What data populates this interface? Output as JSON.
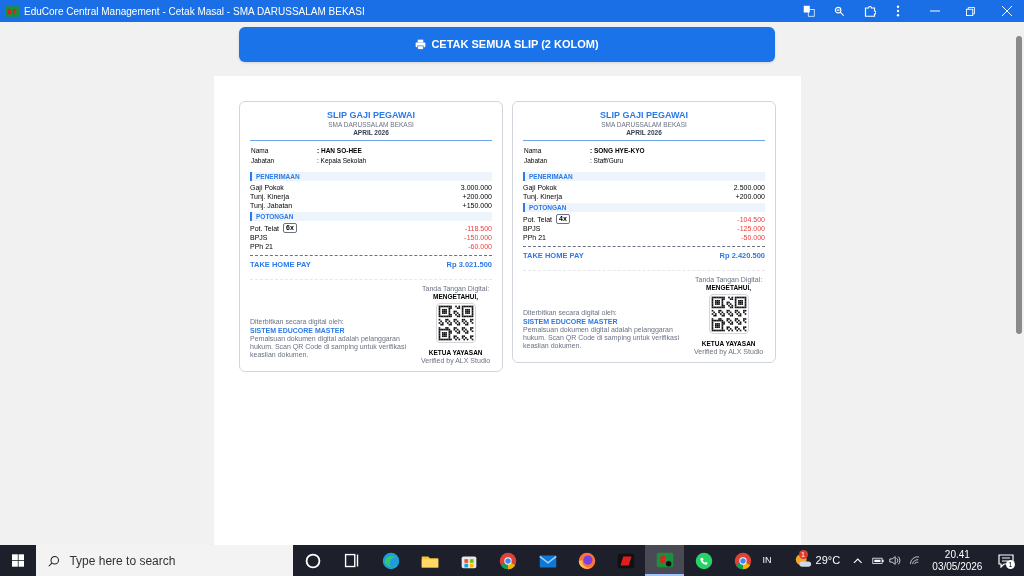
{
  "window": {
    "title": "EduCore Central Management - Cetak Masal - SMA DARUSSALAM BEKASI"
  },
  "print_button": {
    "label": "CETAK SEMUA SLIP (2 KOLOM)"
  },
  "slips": [
    {
      "title": "SLIP GAJI PEGAWAI",
      "school": "SMA DARUSSALAM BEKASI",
      "period": "APRIL 2026",
      "fields": [
        {
          "label": "Nama",
          "value": ": HAN SO-HEE",
          "kind": "name"
        },
        {
          "label": "Jabatan",
          "value": ": Kepala Sekolah",
          "kind": "plain"
        }
      ],
      "earnings_heading": "PENERIMAAN",
      "earnings": [
        {
          "label": "Gaji Pokok",
          "value": "3.000.000"
        },
        {
          "label": "Tunj. Kinerja",
          "value": "+200.000"
        },
        {
          "label": "Tunj. Jabatan",
          "value": "+150.000"
        }
      ],
      "deductions_heading": "POTONGAN",
      "deductions": [
        {
          "label": "Pot. Telat",
          "badge": "6x",
          "value": "-118.500"
        },
        {
          "label": "BPJS",
          "value": "-150.000"
        },
        {
          "label": "PPh 21",
          "value": "-60.000"
        }
      ],
      "total_label": "TAKE HOME PAY",
      "total_value": "Rp 3.021.500",
      "issuer": {
        "caption": "Diterbitkan secara digital oleh:",
        "name": "SISTEM EDUCORE MASTER",
        "note": "Pemalsuan dokumen digital adalah pelanggaran hukum. Scan QR Code di samping untuk verifikasi keaslian dokumen."
      },
      "signature": {
        "caption": "Tanda Tangan Digital:",
        "heading": "MENGETAHUI,",
        "role": "KETUA YAYASAN",
        "verified": "Verified by ALX Studio"
      }
    },
    {
      "title": "SLIP GAJI PEGAWAI",
      "school": "SMA DARUSSALAM BEKASI",
      "period": "APRIL 2026",
      "fields": [
        {
          "label": "Nama",
          "value": ": SONG HYE-KYO",
          "kind": "name"
        },
        {
          "label": "Jabatan",
          "value": ": Staff/Guru",
          "kind": "plain"
        }
      ],
      "earnings_heading": "PENERIMAAN",
      "earnings": [
        {
          "label": "Gaji Pokok",
          "value": "2.500.000"
        },
        {
          "label": "Tunj. Kinerja",
          "value": "+200.000"
        }
      ],
      "deductions_heading": "POTONGAN",
      "deductions": [
        {
          "label": "Pot. Telat",
          "badge": "4x",
          "value": "-104.500"
        },
        {
          "label": "BPJS",
          "value": "-125.000"
        },
        {
          "label": "PPh 21",
          "value": "-50.000"
        }
      ],
      "total_label": "TAKE HOME PAY",
      "total_value": "Rp 2.420.500",
      "issuer": {
        "caption": "Diterbitkan secara digital oleh:",
        "name": "SISTEM EDUCORE MASTER",
        "note": "Pemalsuan dokumen digital adalah pelanggaran hukum. Scan QR Code di samping untuk verifikasi keaslian dokumen."
      },
      "signature": {
        "caption": "Tanda Tangan Digital:",
        "heading": "MENGETAHUI,",
        "role": "KETUA YAYASAN",
        "verified": "Verified by ALX Studio"
      }
    }
  ],
  "taskbar": {
    "search": {
      "placeholder": "Type here to search"
    },
    "apps": [
      {
        "kind": "cortana",
        "selected": false
      },
      {
        "kind": "taskview",
        "selected": false
      },
      {
        "kind": "edge",
        "selected": false
      },
      {
        "kind": "folder",
        "selected": false
      },
      {
        "kind": "store",
        "selected": false
      },
      {
        "kind": "chrome",
        "selected": false
      },
      {
        "kind": "mail",
        "selected": false
      },
      {
        "kind": "firefox",
        "selected": false
      },
      {
        "kind": "redapp",
        "selected": false
      },
      {
        "kind": "educore",
        "selected": true
      },
      {
        "kind": "whatsapp",
        "selected": false
      },
      {
        "kind": "chrome",
        "selected": false
      }
    ],
    "language": "IN",
    "weather_badge": "1",
    "temperature": "29°C",
    "time": "20.41",
    "date": "03/05/2026",
    "notifications": "1"
  }
}
